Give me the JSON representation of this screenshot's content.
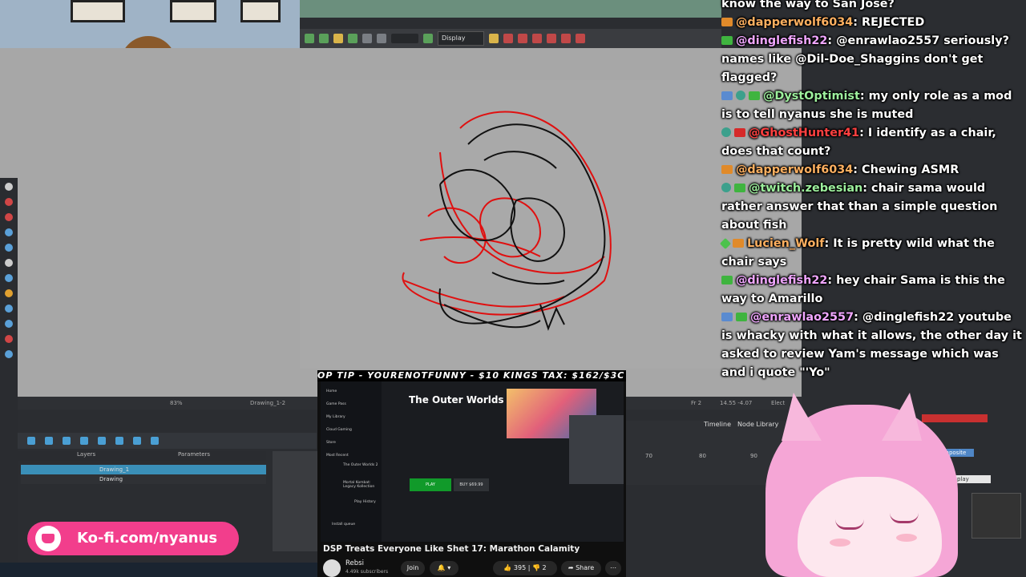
{
  "toolbar": {
    "display_label": "Display"
  },
  "statusbar": {
    "zoom": "83%",
    "drawing": "Drawing_1-2",
    "frame": "Fr 2",
    "coords": "14.55 -4.07",
    "extra": "Elect"
  },
  "layers": {
    "header_left": "Layers",
    "header_right": "Parameters",
    "items": [
      {
        "label": "Drawing_1"
      },
      {
        "label": "Drawing"
      }
    ]
  },
  "right_tabs": {
    "timeline": "Timeline",
    "node_library": "Node Library"
  },
  "timeline_ticks": [
    "70",
    "80",
    "90"
  ],
  "nodes": {
    "composite": "Composite",
    "display": "Display"
  },
  "chat": [
    {
      "badges": [],
      "user": "",
      "text": "know the way to San Jose?"
    },
    {
      "badges": [
        "pr"
      ],
      "user": "@dapperwolf6034",
      "user_style": "o",
      "text": ": REJECTED"
    },
    {
      "badges": [
        "yt"
      ],
      "user": "@dinglefish22",
      "user_style": "",
      "text": ": @enrawlao2557 seriously? names like @Dil-Doe_Shaggins don't get flagged?"
    },
    {
      "badges": [
        "wr",
        "mod",
        "yt"
      ],
      "user": "@DystOptimist",
      "user_style": "g",
      "text": ": my only role as a mod is to tell nyanus she is muted"
    },
    {
      "badges": [
        "mod",
        "red"
      ],
      "user": "@GhostHunter41",
      "user_style": "red",
      "text": ": I identify as a chair, does that count?"
    },
    {
      "badges": [
        "pr"
      ],
      "user": "@dapperwolf6034",
      "user_style": "o",
      "text": ": Chewing ASMR"
    },
    {
      "badges": [
        "mod",
        "yt"
      ],
      "user": "@twitch.zebesian",
      "user_style": "g",
      "text": ": chair sama would rather answer that than a simple question about fish"
    },
    {
      "badges": [
        "star",
        "k"
      ],
      "user": "Lucien_Wolf",
      "user_style": "o",
      "text": ": It is pretty wild what the chair says"
    },
    {
      "badges": [
        "yt"
      ],
      "user": "@dinglefish22",
      "user_style": "",
      "text": ": hey chair Sama is this the way to Amarillo"
    },
    {
      "badges": [
        "wr",
        "yt"
      ],
      "user": "@enrawlao2557",
      "user_style": "",
      "text": ": @dinglefish22 youtube is whacky with what it allows, the other day it asked to review Yam's message which was and i quote \"'Yo\""
    }
  ],
  "video": {
    "ticker": "OP TIP - YOURENOTFUNNY - $10   KINGS TAX: $162/$3C",
    "side_items": [
      "Home",
      "Game Pass",
      "My Library",
      "Cloud Gaming",
      "Store",
      "Most Recent",
      "The Outer Worlds 2",
      "Mortal Kombat: Legacy Kollection",
      "Play History",
      "Install queue"
    ],
    "game_title": "The Outer Worlds 2",
    "play_label": "PLAY",
    "buy_label": "BUY $69.99",
    "title": "DSP Treats Everyone Like Shet 17: Marathon Calamity",
    "channel": "Rebsi",
    "subs": "4.49k subscribers",
    "join": "Join",
    "likes": "395",
    "dislikes": "2",
    "share": "Share"
  },
  "kofi": {
    "text": "Ko-fi.com/nyanus"
  }
}
